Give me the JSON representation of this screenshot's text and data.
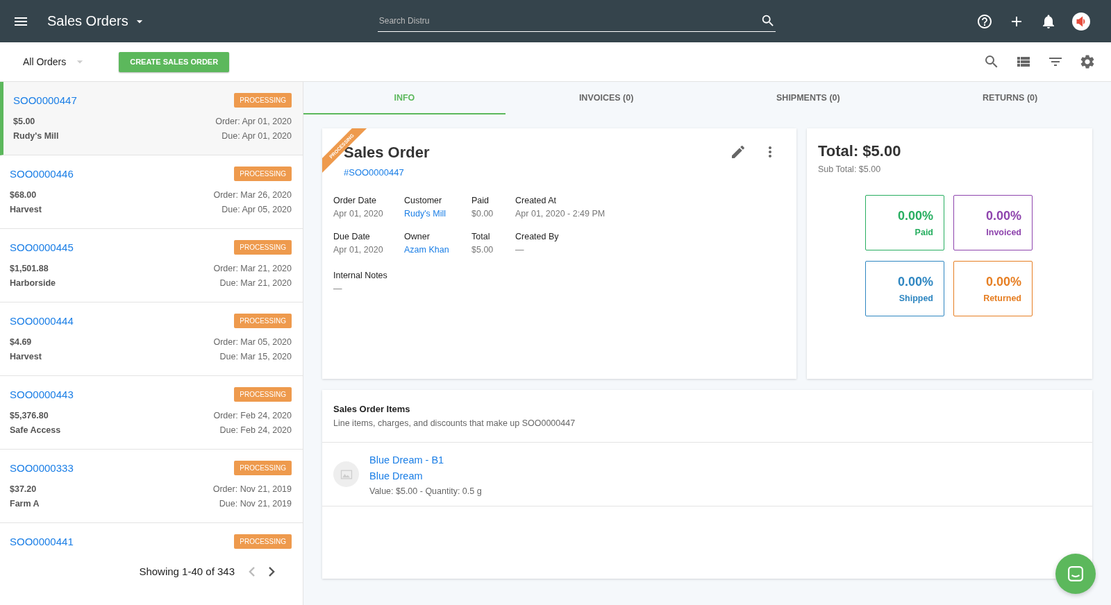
{
  "top_bar": {
    "title": "Sales Orders",
    "search": {
      "placeholder": "Search Distru"
    }
  },
  "toolbar": {
    "filter": "All Orders",
    "create_button": "CREATE SALES ORDER"
  },
  "orders": [
    {
      "id": "SOO0000447",
      "status": "PROCESSING",
      "amount": "$5.00",
      "customer": "Rudy's Mill",
      "order_date": "Order: Apr 01, 2020",
      "due_date": "Due: Apr 01, 2020",
      "selected": true
    },
    {
      "id": "SOO0000446",
      "status": "PROCESSING",
      "amount": "$68.00",
      "customer": "Harvest",
      "order_date": "Order: Mar 26, 2020",
      "due_date": "Due: Apr 05, 2020",
      "selected": false
    },
    {
      "id": "SOO0000445",
      "status": "PROCESSING",
      "amount": "$1,501.88",
      "customer": "Harborside",
      "order_date": "Order: Mar 21, 2020",
      "due_date": "Due: Mar 21, 2020",
      "selected": false
    },
    {
      "id": "SOO0000444",
      "status": "PROCESSING",
      "amount": "$4.69",
      "customer": "Harvest",
      "order_date": "Order: Mar 05, 2020",
      "due_date": "Due: Mar 15, 2020",
      "selected": false
    },
    {
      "id": "SOO0000443",
      "status": "PROCESSING",
      "amount": "$5,376.80",
      "customer": "Safe Access",
      "order_date": "Order: Feb 24, 2020",
      "due_date": "Due: Feb 24, 2020",
      "selected": false
    },
    {
      "id": "SOO0000333",
      "status": "PROCESSING",
      "amount": "$37.20",
      "customer": "Farm A",
      "order_date": "Order: Nov 21, 2019",
      "due_date": "Due: Nov 21, 2019",
      "selected": false
    },
    {
      "id": "SOO0000441",
      "status": "PROCESSING",
      "selected": false
    }
  ],
  "pagination": {
    "text": "Showing 1-40 of 343",
    "prev_disabled": true,
    "next_disabled": false
  },
  "tabs": [
    {
      "label": "INFO",
      "selected": true
    },
    {
      "label": "INVOICES (0)",
      "selected": false
    },
    {
      "label": "SHIPMENTS (0)",
      "selected": false
    },
    {
      "label": "RETURNS (0)",
      "selected": false
    }
  ],
  "detail": {
    "ribbon": "PROCESSING",
    "title": "Sales Order",
    "number": "#SOO0000447",
    "fields": [
      {
        "label": "Order Date",
        "value": "Apr 01, 2020",
        "kind": "text"
      },
      {
        "label": "Customer",
        "value": "Rudy's Mill",
        "kind": "link"
      },
      {
        "label": "Paid",
        "value": "$0.00",
        "kind": "text"
      },
      {
        "label": "Created At",
        "value": "Apr 01, 2020 - 2:49 PM",
        "kind": "text"
      },
      {
        "label": "Due Date",
        "value": "Apr 01, 2020",
        "kind": "text"
      },
      {
        "label": "Owner",
        "value": "Azam Khan",
        "kind": "link"
      },
      {
        "label": "Total",
        "value": "$5.00",
        "kind": "text"
      },
      {
        "label": "Created By",
        "value": "—",
        "kind": "text"
      }
    ],
    "notes": {
      "label": "Internal Notes",
      "value": "—"
    }
  },
  "totals": {
    "total": "Total: $5.00",
    "subtotal": "Sub Total: $5.00",
    "stats": [
      {
        "value": "0.00%",
        "label": "Paid",
        "color": "#27ae60"
      },
      {
        "value": "0.00%",
        "label": "Invoiced",
        "color": "#8e44ad"
      },
      {
        "value": "0.00%",
        "label": "Shipped",
        "color": "#2e86c1"
      },
      {
        "value": "0.00%",
        "label": "Returned",
        "color": "#e67e22"
      }
    ]
  },
  "items": {
    "title": "Sales Order Items",
    "subtitle": "Line items, charges, and discounts that make up SOO0000447",
    "rows": [
      {
        "name": "Blue Dream - B1",
        "product": "Blue Dream",
        "details": "Value: $5.00 - Quantity: 0.5 g"
      }
    ]
  }
}
